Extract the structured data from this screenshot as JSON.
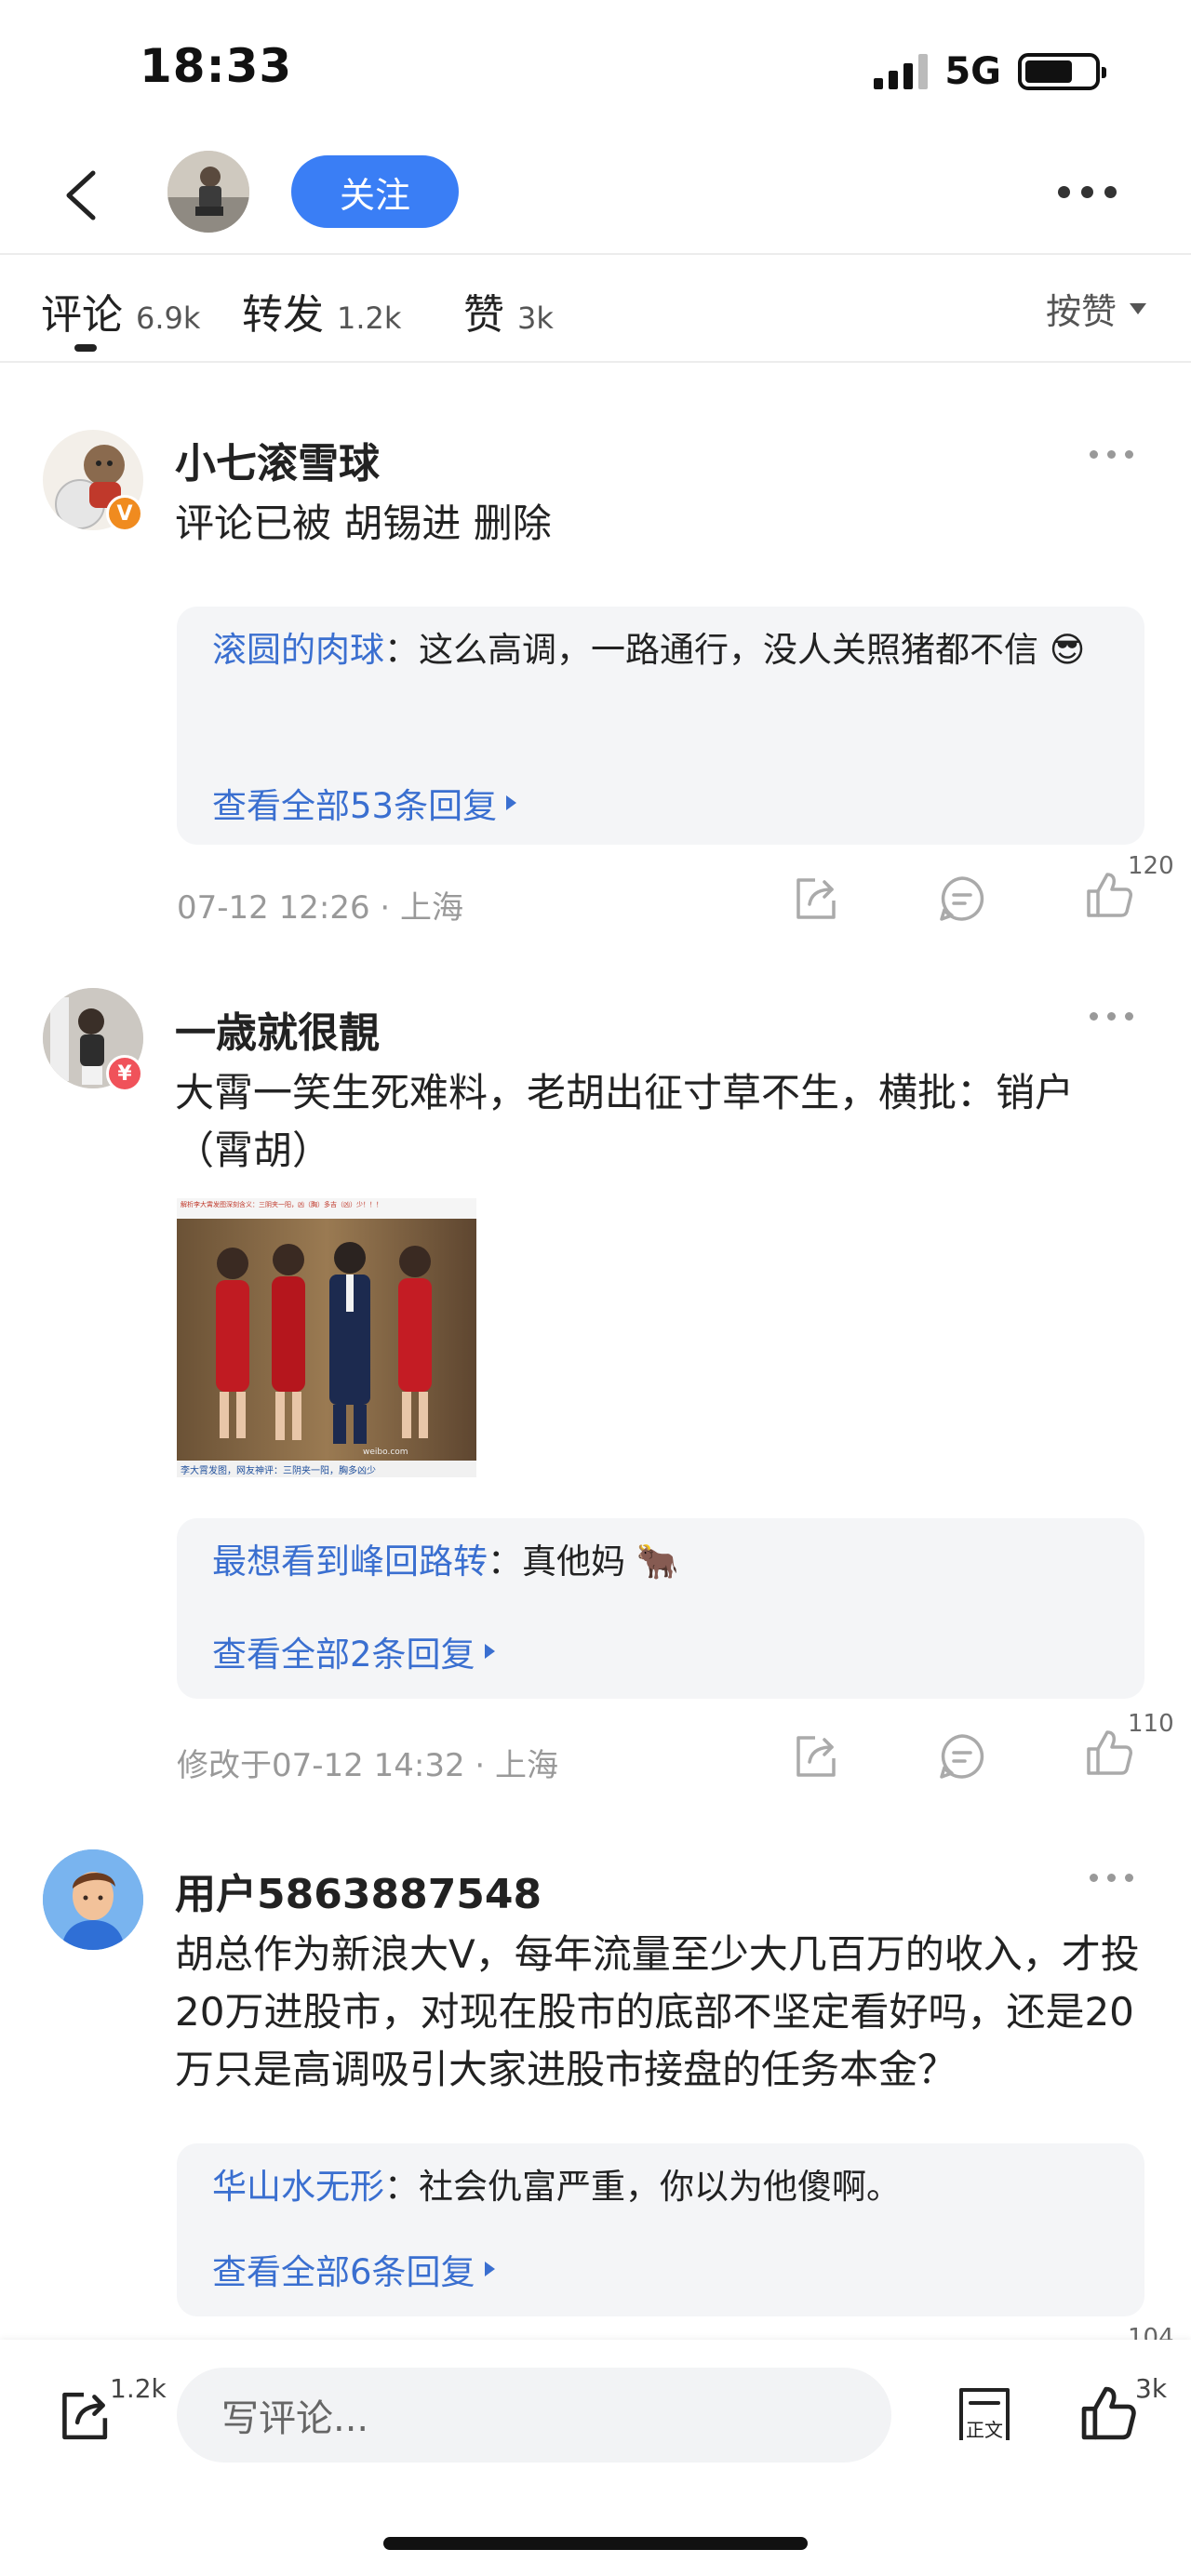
{
  "status_bar": {
    "time": "18:33",
    "network": "5G"
  },
  "nav": {
    "follow_label": "关注"
  },
  "tabs": [
    {
      "label": "评论",
      "count": "6.9k"
    },
    {
      "label": "转发",
      "count": "1.2k"
    },
    {
      "label": "赞",
      "count": "3k"
    }
  ],
  "sort": {
    "selected": "按赞"
  },
  "comments": [
    {
      "name": "小七滚雪球",
      "badge": "V",
      "text": "评论已被 胡锡进 删除",
      "reply": {
        "user": "滚圆的肉球",
        "sep": "：",
        "text": "这么高调，一路通行，没人关照猪都不信",
        "emoji": "😎"
      },
      "view_all": "查看全部53条回复",
      "meta": "07-12 12:26 · 上海",
      "like_count": "120"
    },
    {
      "name": "一歳就很靚",
      "badge": "¥",
      "text": "大霄一笑生死难料，老胡出征寸草不生，横批：销户（霄胡）",
      "image_caption_top": "解析李大霄发图深刻含义：三阴夹一阳，凶（胸）多吉（凶）少！！！",
      "image_caption_bottom": "李大霄发图，网友神评：三阴夹一阳，胸多凶少",
      "image_watermark": "weibo.com",
      "reply": {
        "user": "最想看到峰回路转",
        "sep": "：",
        "text": "真他妈",
        "emoji": "🐂"
      },
      "view_all": "查看全部2条回复",
      "meta": "修改于07-12 14:32 · 上海",
      "like_count": "110"
    },
    {
      "name": "用户5863887548",
      "text": "胡总作为新浪大V，每年流量至少大几百万的收入，才投20万进股市，对现在股市的底部不坚定看好吗，还是20万只是高调吸引大家进股市接盘的任务本金？",
      "reply": {
        "user": "华山水无形",
        "sep": "：",
        "text": "社会仇富严重，你以为他傻啊。"
      },
      "view_all": "查看全部6条回复",
      "like_count": "104"
    }
  ],
  "bottom_bar": {
    "share_count": "1.2k",
    "input_placeholder": "写评论...",
    "article_label": "正文",
    "like_count": "3k"
  },
  "colors": {
    "accent": "#3a7ef5",
    "link": "#3a6fd0",
    "muted": "#999999",
    "reply_bg": "#f4f5f7"
  }
}
